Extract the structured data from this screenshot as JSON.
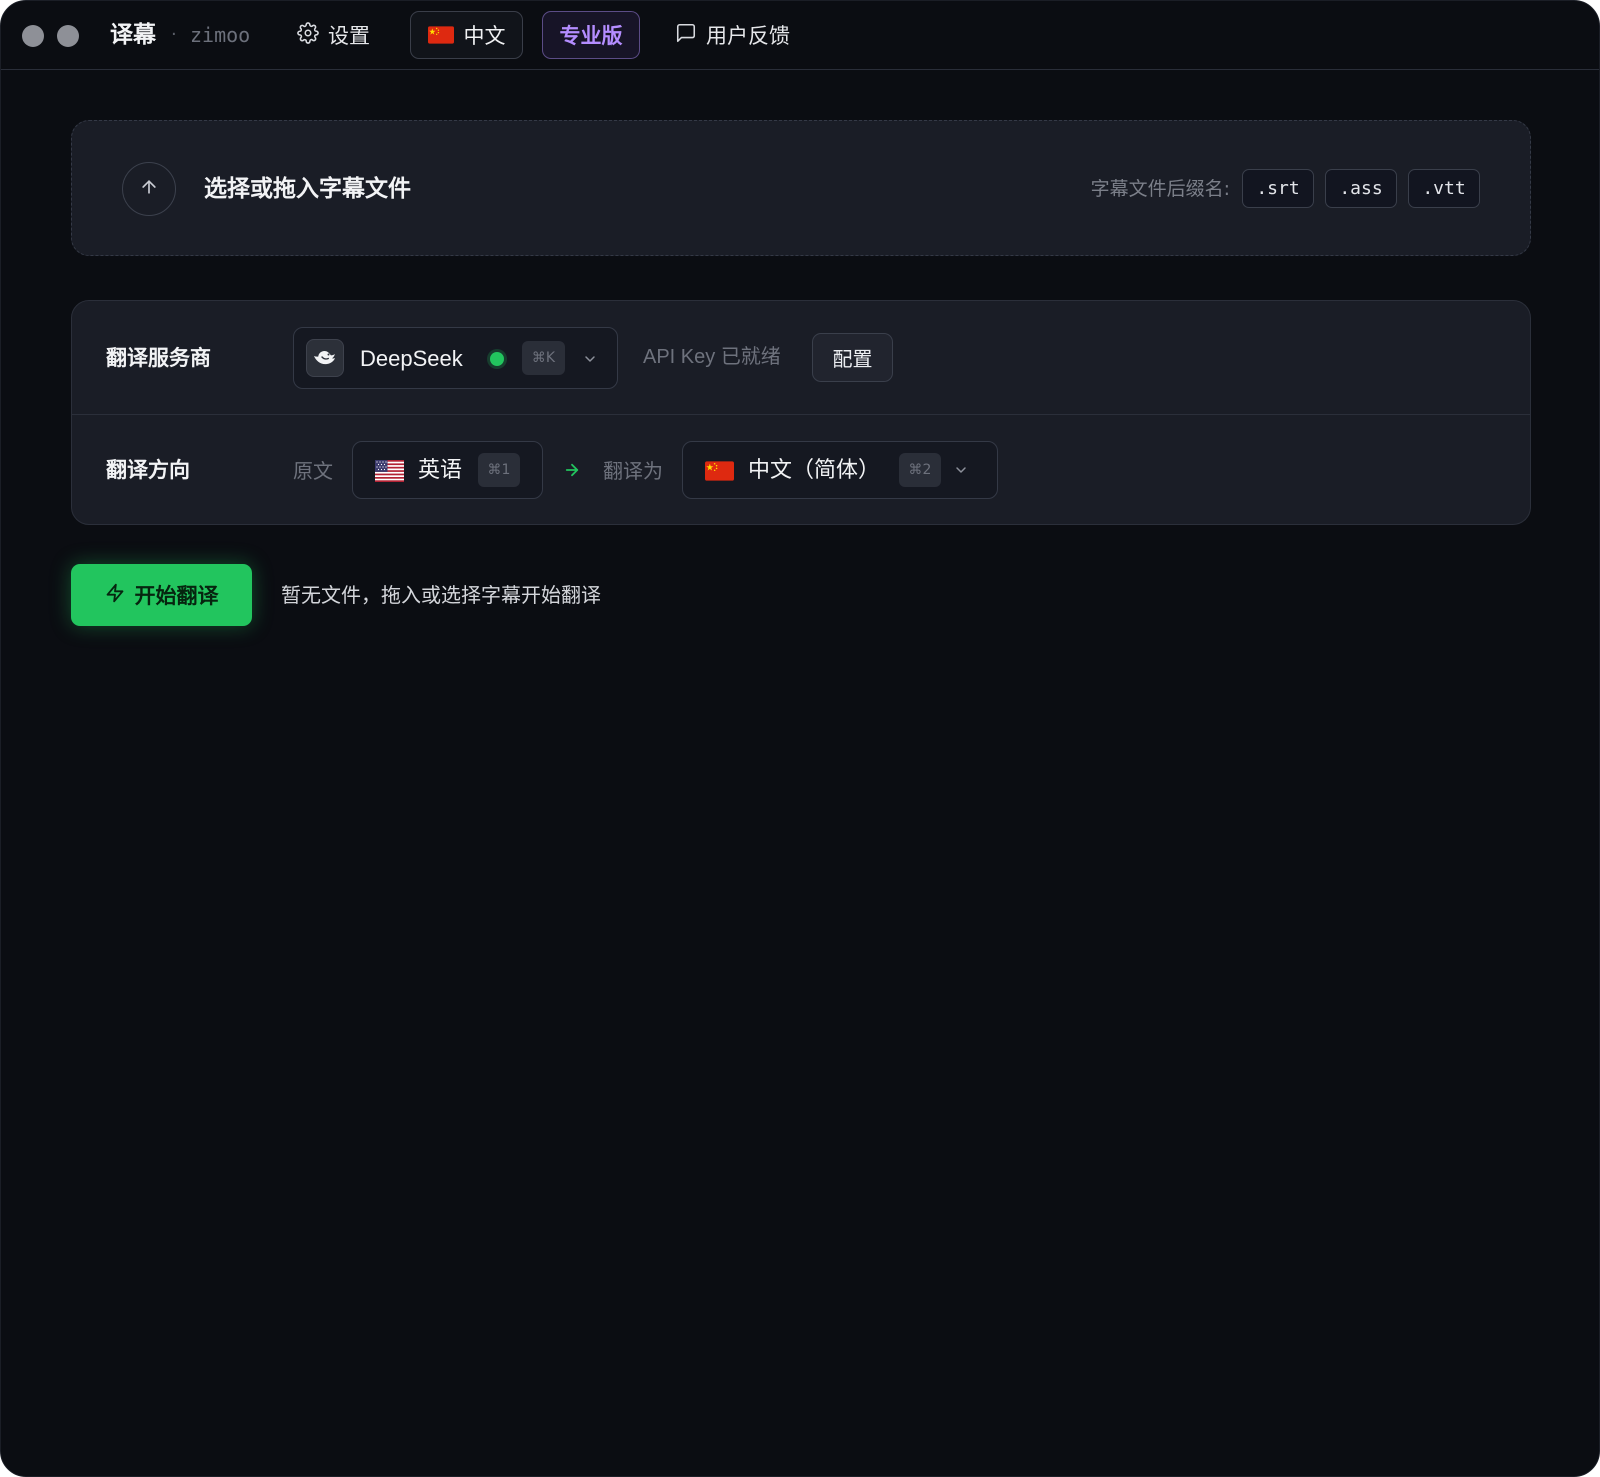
{
  "titlebar": {
    "app_name": "译幕",
    "separator": "·",
    "subtitle": "zimoo",
    "settings_label": "设置",
    "language_button_label": "中文",
    "pro_button_label": "专业版",
    "feedback_label": "用户反馈"
  },
  "dropzone": {
    "title": "选择或拖入字幕文件",
    "extensions_label": "字幕文件后缀名:",
    "extensions": [
      ".srt",
      ".ass",
      ".vtt"
    ]
  },
  "provider": {
    "label": "翻译服务商",
    "name": "DeepSeek",
    "status_color": "#22c55e",
    "shortcut": "⌘K",
    "api_status": "API Key 已就绪",
    "config_label": "配置"
  },
  "direction": {
    "label": "翻译方向",
    "source_label": "原文",
    "source_language": "英语",
    "source_shortcut": "⌘1",
    "target_label": "翻译为",
    "target_language": "中文（简体）",
    "target_shortcut": "⌘2"
  },
  "action": {
    "start_label": "开始翻译",
    "hint": "暂无文件，拖入或选择字幕开始翻译"
  },
  "colors": {
    "accent_green": "#22c55e",
    "pro_purple": "#b48dff",
    "background": "#0b0d12"
  }
}
